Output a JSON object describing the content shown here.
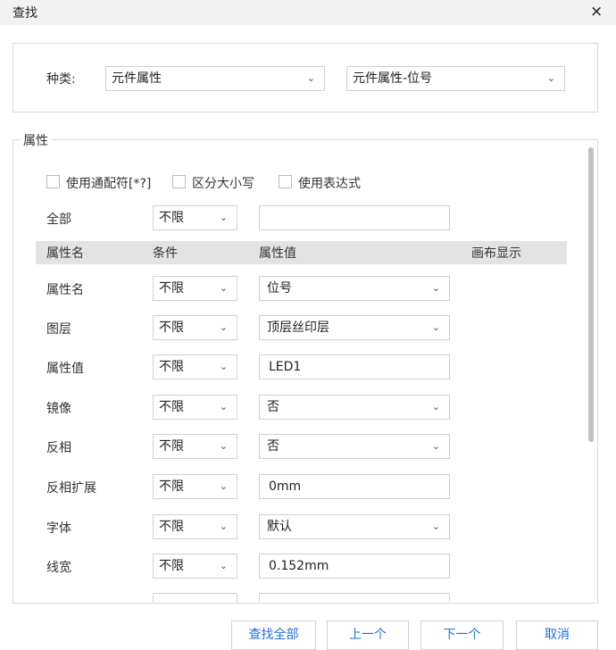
{
  "dialog": {
    "title": "查找",
    "close_icon": "×"
  },
  "kind": {
    "label": "种类:",
    "select1": "元件属性",
    "select2": "元件属性-位号"
  },
  "properties": {
    "legend": "属性",
    "checkboxes": [
      "使用通配符[*?]",
      "区分大小写",
      "使用表达式"
    ],
    "all": {
      "label": "全部",
      "condition": "不限",
      "value": ""
    },
    "headers": [
      "属性名",
      "条件",
      "属性值",
      "画布显示"
    ],
    "rows": [
      {
        "name": "属性名",
        "condition": "不限",
        "value": "位号",
        "type": "select"
      },
      {
        "name": "图层",
        "condition": "不限",
        "value": "顶层丝印层",
        "type": "select"
      },
      {
        "name": "属性值",
        "condition": "不限",
        "value": "LED1",
        "type": "input"
      },
      {
        "name": "镜像",
        "condition": "不限",
        "value": "否",
        "type": "select"
      },
      {
        "name": "反相",
        "condition": "不限",
        "value": "否",
        "type": "select"
      },
      {
        "name": "反相扩展",
        "condition": "不限",
        "value": "0mm",
        "type": "input"
      },
      {
        "name": "字体",
        "condition": "不限",
        "value": "默认",
        "type": "select"
      },
      {
        "name": "线宽",
        "condition": "不限",
        "value": "0.152mm",
        "type": "input"
      }
    ]
  },
  "buttons": {
    "find_all": "查找全部",
    "prev": "上一个",
    "next": "下一个",
    "cancel": "取消"
  },
  "icons": {
    "chevron": "chevron-down-icon",
    "close": "close-icon"
  },
  "colors": {
    "accent": "#1e6fd9",
    "header_bg": "#e3e3e3",
    "titlebar_bg": "#f2f2f2"
  }
}
